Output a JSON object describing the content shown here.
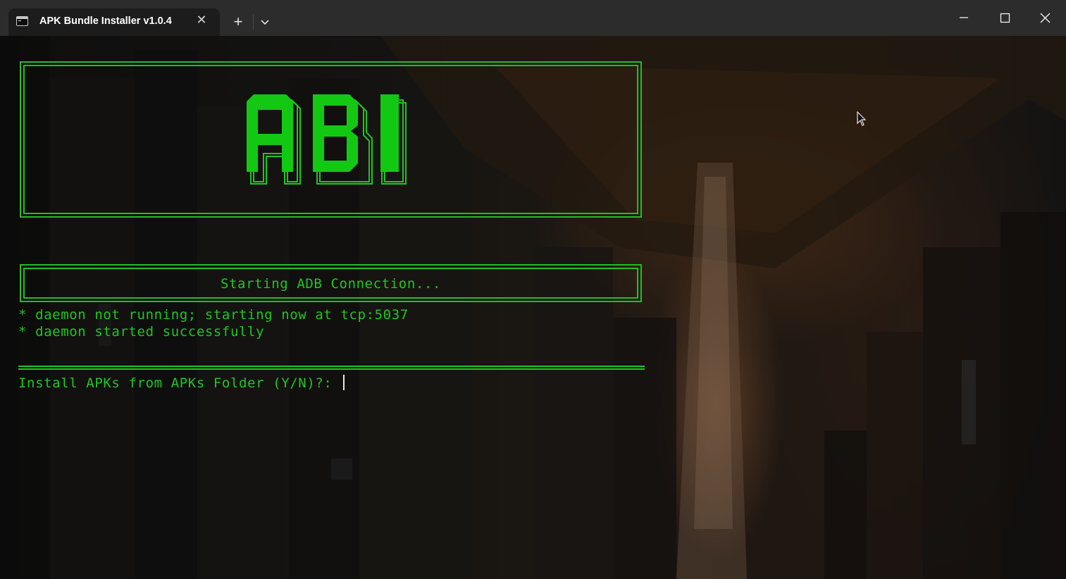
{
  "window": {
    "tab_title": "APK Bundle Installer v1.0.4",
    "tab_icon": "terminal-icon",
    "new_tab_label": "+",
    "tab_close_label": "✕"
  },
  "logo": {
    "text": "ABI",
    "color": "#22c422"
  },
  "status": {
    "message": "Starting ADB Connection..."
  },
  "log": [
    "* daemon not running; starting now at tcp:5037",
    "* daemon started successfully"
  ],
  "prompt": {
    "text": "Install APKs from APKs Folder (Y/N)?: "
  },
  "theme": {
    "accent": "#22c422",
    "titlebar": "#2c2c2c",
    "tab": "#1c1c1c"
  }
}
